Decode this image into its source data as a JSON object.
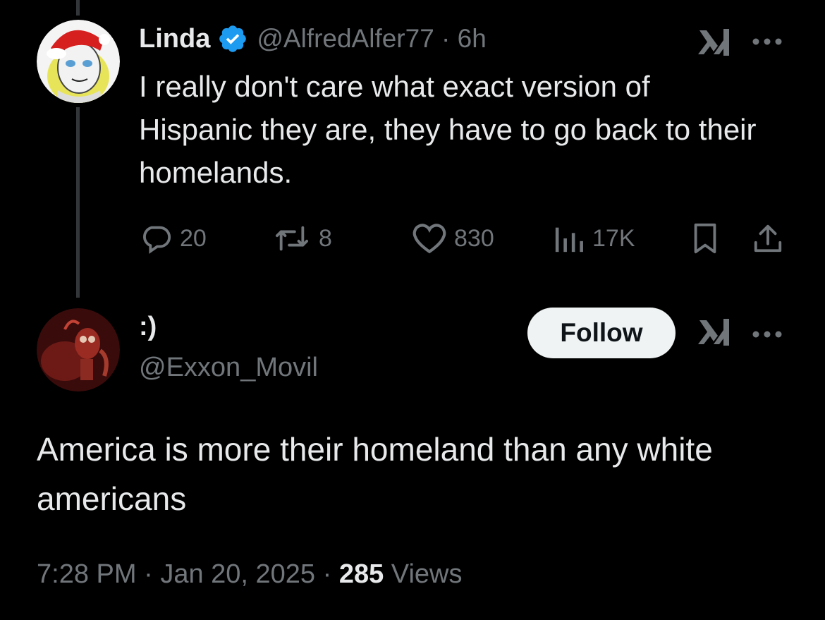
{
  "parent_tweet": {
    "display_name": "Linda",
    "handle_time": "@AlfredAlfer77 · 6h",
    "verified_color": "#1d9bf0",
    "text": "I really don't care what exact version of Hispanic they are, they have to go back to their homelands.",
    "stats": {
      "replies": "20",
      "reposts": "8",
      "likes": "830",
      "views": "17K"
    }
  },
  "reply_tweet": {
    "display_name": ":)",
    "handle": "@Exxon_Movil",
    "follow_label": "Follow",
    "text": "America is more their homeland than any white americans",
    "meta": {
      "time": "7:28 PM",
      "sep1": " · ",
      "date": "Jan 20, 2025",
      "sep2": " · ",
      "views_count": "285",
      "views_label": " Views"
    }
  },
  "icons": {
    "reply": "reply-bubble-icon",
    "repost": "repost-icon",
    "like": "heart-icon",
    "views": "views-bars-icon",
    "bookmark": "bookmark-icon",
    "share": "share-icon",
    "grok": "grok-icon",
    "more": "more-dots-icon",
    "verified": "verified-badge-icon"
  },
  "colors": {
    "background": "#000000",
    "primary_text": "#e7e9ea",
    "secondary_text": "#71767b",
    "follow_button_bg": "#eff3f4",
    "follow_button_text": "#0f1419"
  }
}
